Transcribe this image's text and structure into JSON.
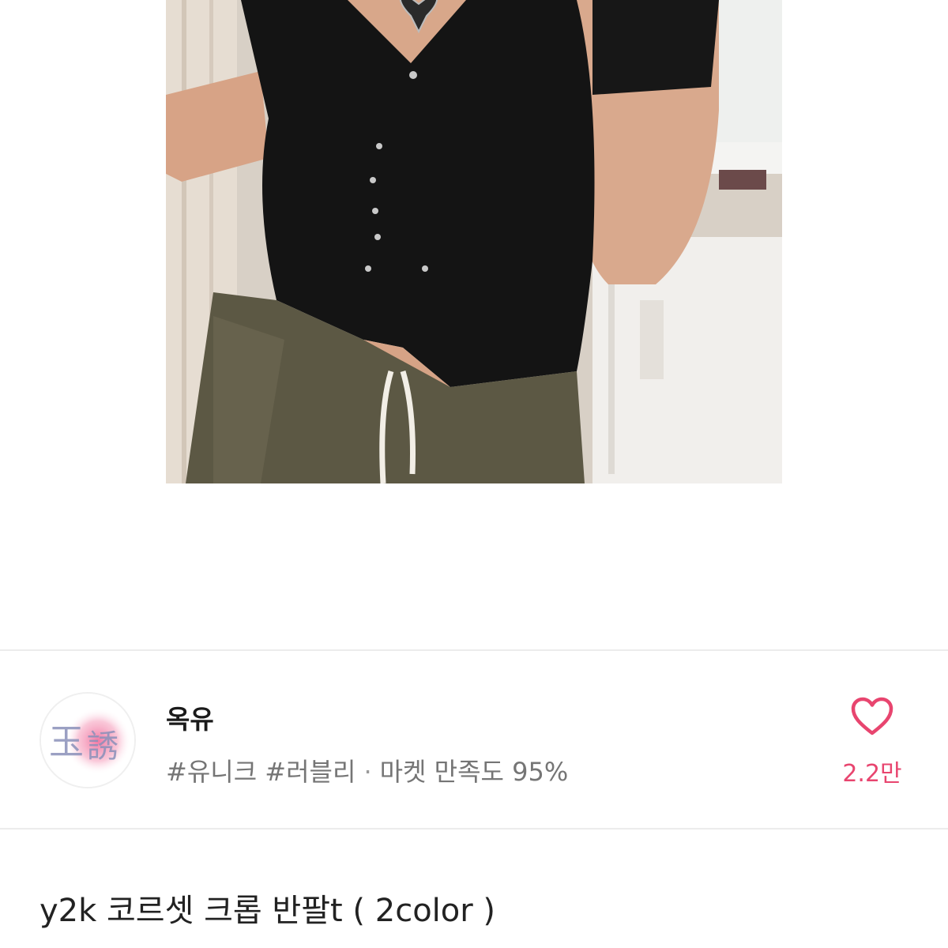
{
  "product_image": {
    "icon": "product-photo"
  },
  "seller": {
    "avatar_text": "玉誘",
    "name": "옥유",
    "tags": "#유니크 #러블리",
    "separator": "·",
    "satisfaction": "마켓 만족도 95%"
  },
  "like": {
    "icon": "heart-icon",
    "count": "2.2만",
    "color": "#e8456f"
  },
  "product": {
    "title": "y2k 코르셋 크롭 반팔t ( 2color )"
  }
}
